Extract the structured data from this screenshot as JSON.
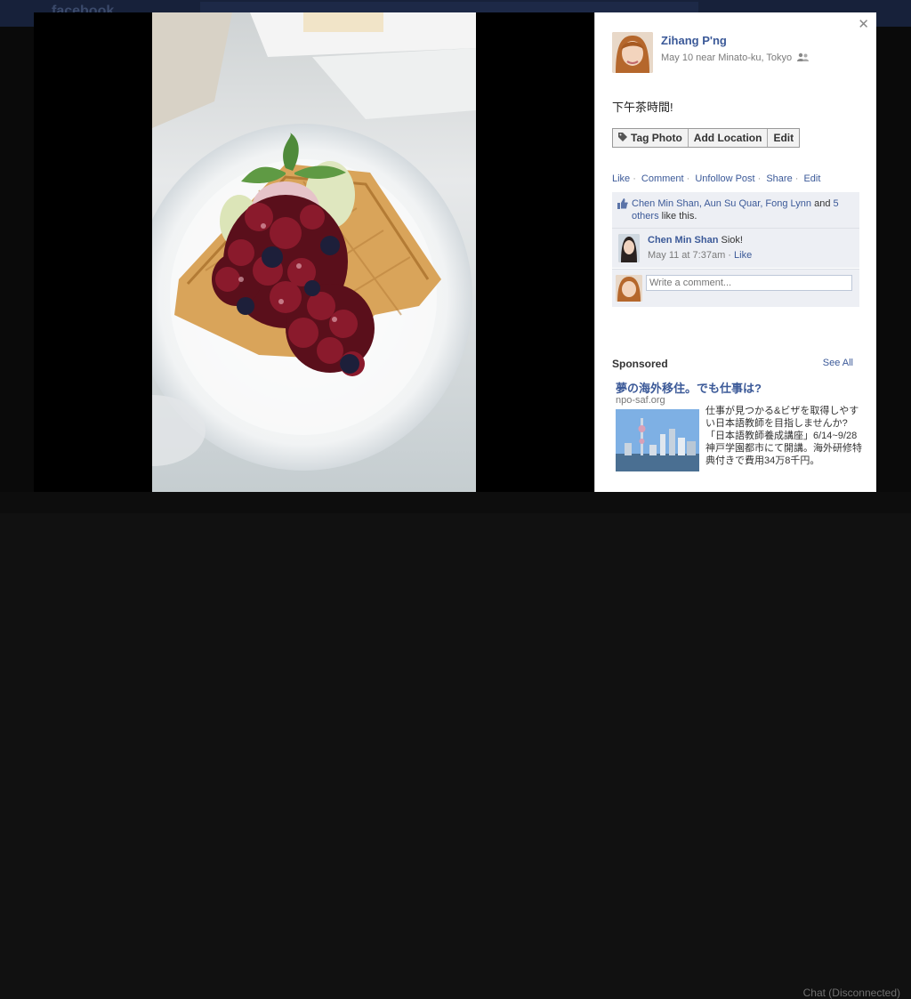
{
  "page": {
    "brand": "facebook",
    "chat_status": "Chat (Disconnected)"
  },
  "post": {
    "author": "Zihang P'ng",
    "meta_text": "May 10 near Minato-ku, Tokyo",
    "caption": "下午茶時間!",
    "buttons": {
      "tag_photo": "Tag Photo",
      "add_location": "Add Location",
      "edit": "Edit"
    },
    "actions": {
      "like": "Like",
      "comment": "Comment",
      "unfollow": "Unfollow Post",
      "share": "Share",
      "edit": "Edit"
    },
    "likes": {
      "names": "Chen Min Shan, Aun Su Quar, Fong Lynn",
      "and": "and",
      "others": "5 others",
      "suffix": "like this."
    },
    "comment": {
      "author": "Chen Min Shan",
      "text": "Siok!",
      "time": "May 11 at 7:37am",
      "like": "Like"
    },
    "comment_placeholder": "Write a comment..."
  },
  "sponsored": {
    "heading": "Sponsored",
    "see_all": "See All",
    "ad": {
      "title": "夢の海外移住。でも仕事は?",
      "domain": "npo-saf.org",
      "body": "仕事が見つかる&ビザを取得しやすい日本語教師を目指しませんか?「日本語教師養成講座」6/14~9/28神戸学園都市にて開講。海外研修特典付きで費用34万8千円。"
    }
  },
  "icons": {
    "close": "close-icon",
    "audience": "friends-audience-icon",
    "tag": "tag-icon",
    "like": "thumbs-up-icon"
  },
  "colors": {
    "link": "#3b5998",
    "panel_bg": "#ffffff",
    "comment_bg": "#edeff4"
  }
}
